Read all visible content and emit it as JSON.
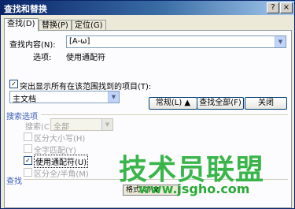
{
  "window": {
    "title": "查找和替换",
    "help_glyph": "?",
    "close_glyph": "×"
  },
  "tabs": [
    {
      "label": "查找(D)"
    },
    {
      "label": "替换(P)"
    },
    {
      "label": "定位(G)"
    }
  ],
  "find": {
    "label": "查找内容(N):",
    "value": "[A-ω]",
    "options_label": "选项:",
    "options_value": "使用通配符"
  },
  "highlight": {
    "label": "突出显示所有在该范围找到的项目(T):",
    "checked_glyph": "✓",
    "scope_value": "主文档"
  },
  "buttons": {
    "less": "常规(L) ▲",
    "find_all": "查找全部(F)",
    "close": "关闭"
  },
  "search_options": {
    "section_label": "搜索选项",
    "search_label": "搜索(C):",
    "search_value": "全部",
    "match_case": "区分大小写(H)",
    "whole_word": "全字匹配(Y)",
    "wildcards": "使用通配符(U)",
    "wildcards_glyph": "✓",
    "width": "区分全/半角(M)"
  },
  "find_section": {
    "label": "查找",
    "format_button": "格式(O) ▼"
  },
  "watermark": {
    "main": "技术员联盟",
    "url": "www.jsgho.com"
  },
  "colors": {
    "title_start": "#0a246a",
    "title_end": "#a6caf0",
    "watermark": "#39b54a"
  }
}
